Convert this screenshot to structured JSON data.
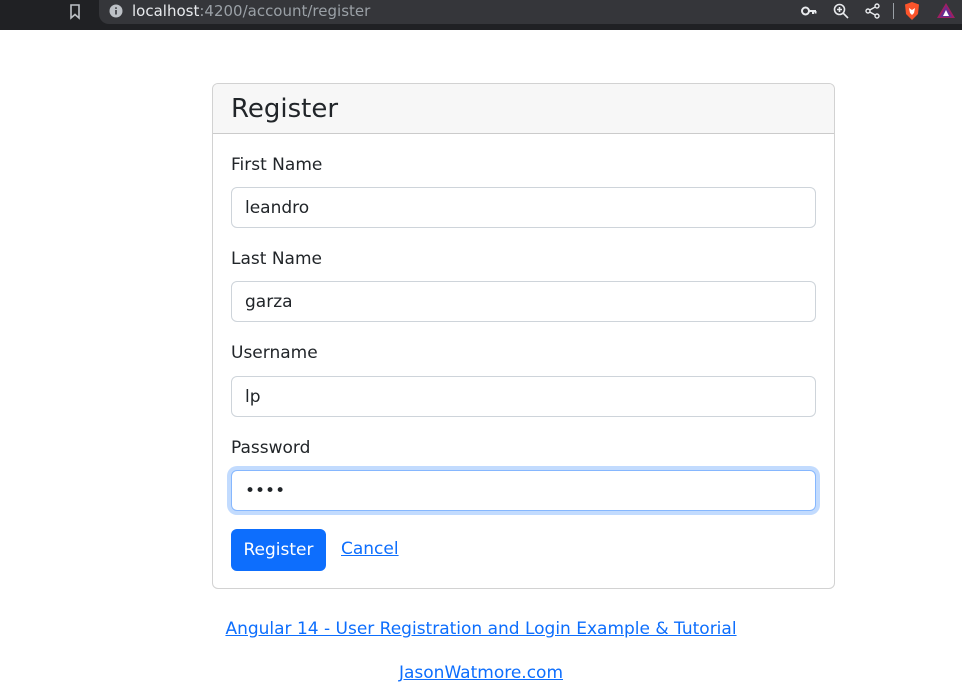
{
  "browser": {
    "url_host": "localhost",
    "url_path": ":4200/account/register",
    "icons": [
      "bookmark-icon",
      "info-icon",
      "key-icon",
      "zoom-icon",
      "share-icon",
      "brave-shield-icon",
      "brave-rewards-icon"
    ]
  },
  "register": {
    "title": "Register",
    "fields": [
      {
        "label": "First Name",
        "value": "leandro"
      },
      {
        "label": "Last Name",
        "value": "garza"
      },
      {
        "label": "Username",
        "value": "lp"
      },
      {
        "label": "Password",
        "value": "••••"
      }
    ],
    "submit_label": "Register",
    "cancel_label": "Cancel"
  },
  "footer": {
    "tutorial_link": "Angular 14 - User Registration and Login Example & Tutorial",
    "author_link": "JasonWatmore.com"
  },
  "colors": {
    "primary": "#0d6efd",
    "focus_ring": "#86b7fe",
    "toolbar": "#202124",
    "brave_orange": "#fb542b"
  }
}
